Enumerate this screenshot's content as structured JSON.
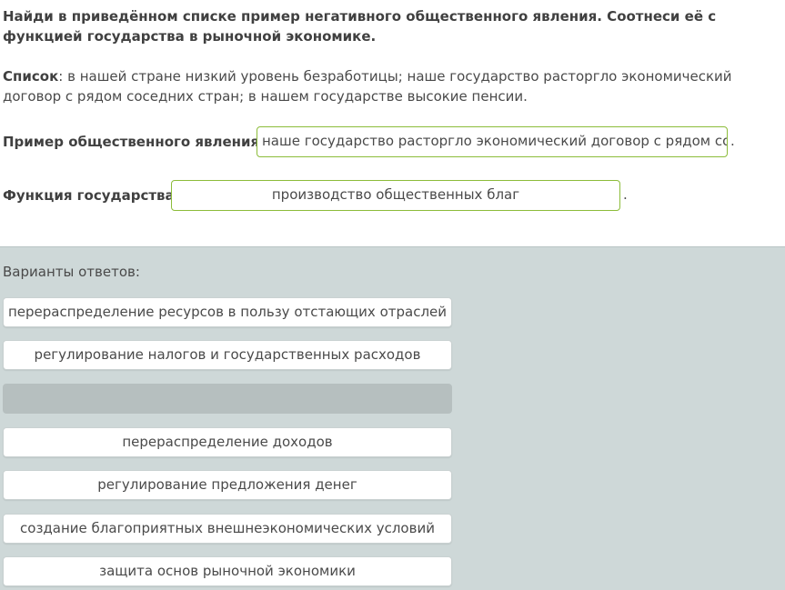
{
  "question": {
    "title": "Найди в приведённом списке пример негативного общественного явления. Соотнеси её с функцией государства в рыночной экономике.",
    "list_label": "Список",
    "list_text": ": в нашей стране низкий уровень безработицы; наше государство расторгло экономический договор с рядом соседних стран; в нашем государстве высокие пенсии."
  },
  "answers": {
    "example_label": "Пример общественного явления:",
    "example_value": "наше государство расторгло экономический договор с рядом со",
    "function_label": "Функция государства:",
    "function_value": "производство общественных благ",
    "period": "."
  },
  "variants": {
    "title": "Варианты ответов:",
    "options": [
      "перераспределение ресурсов в пользу отстающих отраслей",
      "регулирование налогов и государственных расходов",
      "",
      "перераспределение доходов",
      "регулирование предложения денег",
      "создание благоприятных внешнеэкономических условий",
      "защита основ рыночной экономики"
    ]
  }
}
